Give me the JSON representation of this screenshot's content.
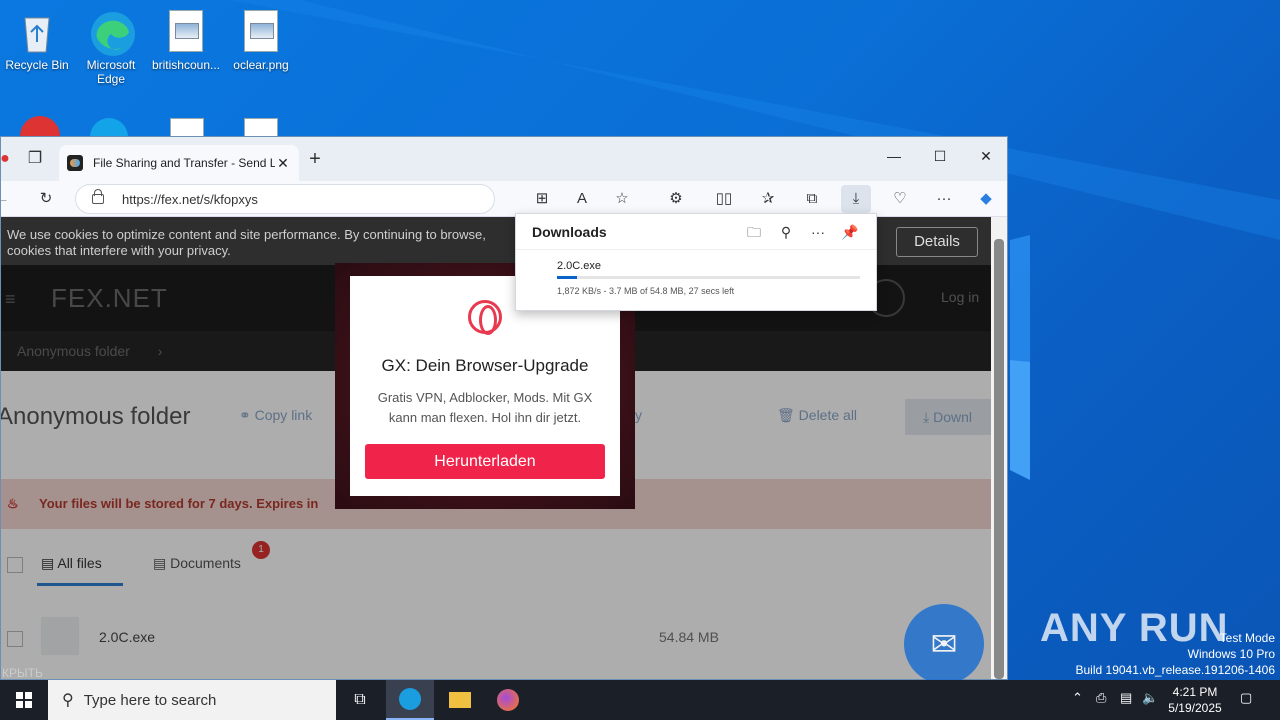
{
  "desktop": {
    "icons": [
      {
        "label": "Recycle Bin"
      },
      {
        "label": "Microsoft Edge"
      },
      {
        "label": "britishcoun..."
      },
      {
        "label": "oclear.png"
      }
    ]
  },
  "browser": {
    "tab_title": "File Sharing and Transfer - Send L",
    "url": "https://fex.net/s/kfopxys",
    "controls": {
      "minimize": "—",
      "maximize": "☐",
      "close": "✕"
    }
  },
  "page": {
    "cookie_text": "We use cookies to optimize content and site performance. By continuing to browse, cookies that interfere with your privacy.",
    "details_label": "Details",
    "logo": "FEX.NET",
    "login": "Log in",
    "breadcrumb": "Anonymous folder",
    "folder_title": "Anonymous folder",
    "copy_link": "Copy link",
    "delete_all": "Delete all",
    "download": "Downl",
    "expire_text": "Your files will be stored for 7 days. Expires in",
    "tab_all_files": "All files",
    "tab_documents": "Documents",
    "documents_badge": "1",
    "file_name": "2.0C.exe",
    "file_size": "54.84 MB",
    "side_hint": "y"
  },
  "ad": {
    "title": "GX: Dein Browser-Upgrade",
    "body": "Gratis VPN, Adblocker, Mods. Mit GX kann man flexen. Hol ihn dir jetzt.",
    "cta": "Herunterladen"
  },
  "downloads": {
    "title": "Downloads",
    "file": "2.0C.exe",
    "progress": 0.0675,
    "meta": "1,872 KB/s - 3.7 MB of 54.8 MB, 27 secs left"
  },
  "taskbar": {
    "search_placeholder": "Type here to search",
    "time": "4:21 PM",
    "date": "5/19/2025"
  },
  "watermark": {
    "brand": "ANY RUN",
    "test_mode": "Test Mode",
    "os": "Windows 10 Pro",
    "build": "Build 19041.vb_release.191206-1406"
  },
  "hidden_label": "КРЫТЬ"
}
